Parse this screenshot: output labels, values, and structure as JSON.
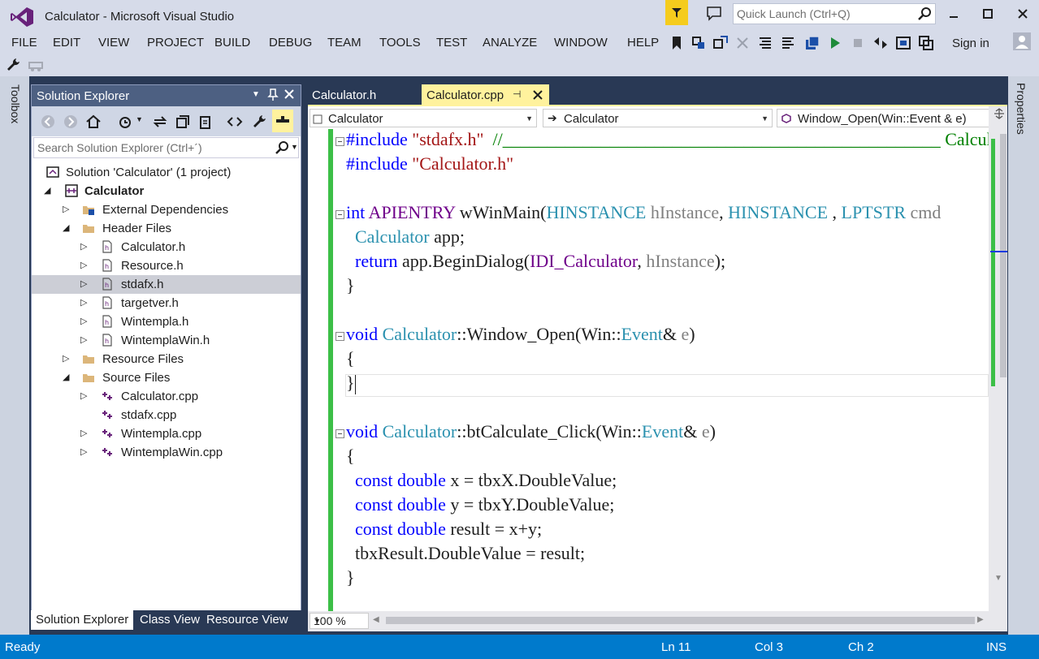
{
  "window": {
    "title": "Calculator - Microsoft Visual Studio",
    "quick_launch_placeholder": "Quick Launch (Ctrl+Q)"
  },
  "colors": {
    "accent": "#007acc",
    "title_bg": "#d6dbe9",
    "panel_header": "#4d6082",
    "active_tab": "#fff29d",
    "change_bar": "#3cbf47",
    "notify": "#f5cc1d"
  },
  "menu": [
    "FILE",
    "EDIT",
    "VIEW",
    "PROJECT",
    "BUILD",
    "DEBUG",
    "TEAM",
    "TOOLS",
    "TEST",
    "ANALYZE",
    "WINDOW",
    "HELP"
  ],
  "signin": "Sign in",
  "rails": {
    "left": "Toolbox",
    "right": "Properties"
  },
  "solution_explorer": {
    "title": "Solution Explorer",
    "search_placeholder": "Search Solution Explorer (Ctrl+´)",
    "tree": [
      {
        "label": "Solution 'Calculator' (1 project)",
        "icon": "solution-icon"
      },
      {
        "label": "Calculator",
        "icon": "cpp-project-icon"
      },
      {
        "label": "External Dependencies",
        "icon": "dependencies-icon"
      },
      {
        "label": "Header Files",
        "icon": "folder-icon"
      },
      {
        "label": "Calculator.h",
        "icon": "header-file-icon"
      },
      {
        "label": "Resource.h",
        "icon": "header-file-icon"
      },
      {
        "label": "stdafx.h",
        "icon": "header-file-icon"
      },
      {
        "label": "targetver.h",
        "icon": "header-file-icon"
      },
      {
        "label": "Wintempla.h",
        "icon": "header-file-icon"
      },
      {
        "label": "WintemplaWin.h",
        "icon": "header-file-icon"
      },
      {
        "label": "Resource Files",
        "icon": "folder-icon"
      },
      {
        "label": "Source Files",
        "icon": "folder-icon"
      },
      {
        "label": "Calculator.cpp",
        "icon": "cpp-file-icon"
      },
      {
        "label": "stdafx.cpp",
        "icon": "cpp-file-icon"
      },
      {
        "label": "Wintempla.cpp",
        "icon": "cpp-file-icon"
      },
      {
        "label": "WintemplaWin.cpp",
        "icon": "cpp-file-icon"
      }
    ],
    "bottom_tabs": [
      "Solution Explorer",
      "Class View",
      "Resource View"
    ]
  },
  "editor": {
    "tabs": [
      "Calculator.h",
      "Calculator.cpp"
    ],
    "nav": {
      "scope": "Calculator",
      "class": "Calculator",
      "member": "Window_Open(Win::Event & e)"
    },
    "zoom": "100 %"
  },
  "status": {
    "ready": "Ready",
    "line": "Ln 11",
    "col": "Col 3",
    "ch": "Ch 2",
    "mode": "INS"
  }
}
